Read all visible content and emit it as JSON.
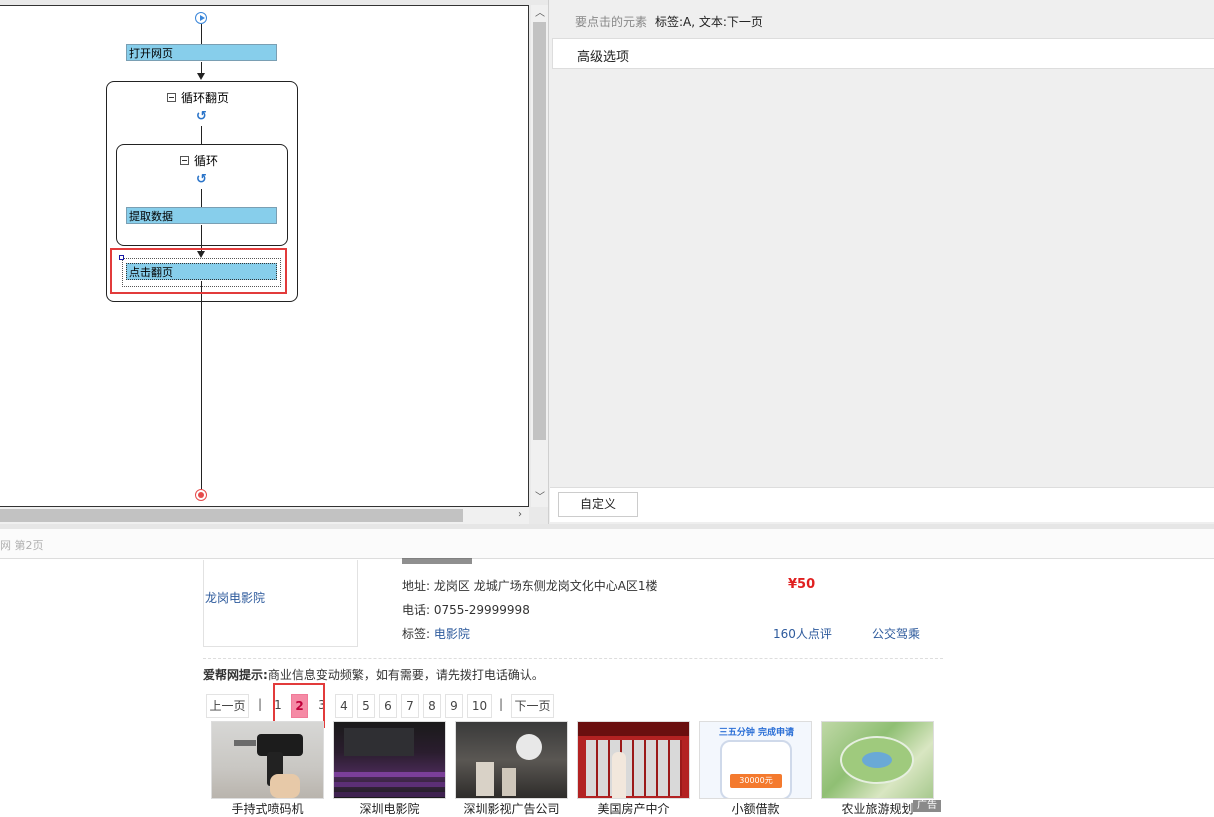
{
  "workflow": {
    "steps": {
      "open_page": "打开网页",
      "loop_pages": "循环翻页",
      "loop": "循环",
      "extract": "提取数据",
      "click_next": "点击翻页"
    }
  },
  "properties": {
    "clicked_element_label": "要点击的元素",
    "clicked_element_value": "标签:A, 文本:下一页",
    "advanced_options": "高级选项",
    "custom_button": "自定义"
  },
  "browser": {
    "tab_text": "网 第2页",
    "listing": {
      "name": "龙岗电影院",
      "address_label": "地址:",
      "address": "龙岗区 龙城广场东侧龙岗文化中心A区1楼",
      "phone_label": "电话:",
      "phone": "0755-29999998",
      "tags_label": "标签:",
      "tag": "电影院",
      "price": "¥50",
      "reviews": "160人点评",
      "transit": "公交驾乘"
    },
    "tip_bold": "爱帮网提示:",
    "tip_text": "商业信息变动频繁，如有需要，请先拨打电话确认。",
    "pagination": {
      "prev": "上一页",
      "sep": "|",
      "pages": [
        "1",
        "2",
        "3",
        "4",
        "5",
        "6",
        "7",
        "8",
        "9",
        "10"
      ],
      "current": "2",
      "next": "下一页"
    },
    "ads": {
      "captions": [
        "手持式喷码机",
        "深圳电影院",
        "深圳影视广告公司",
        "美国房产中介",
        "小额借款",
        "农业旅游规划"
      ],
      "ad_tag": "广告",
      "loan_banner_1": "三五分钟 完成申请",
      "loan_banner_2": "30000元"
    }
  }
}
